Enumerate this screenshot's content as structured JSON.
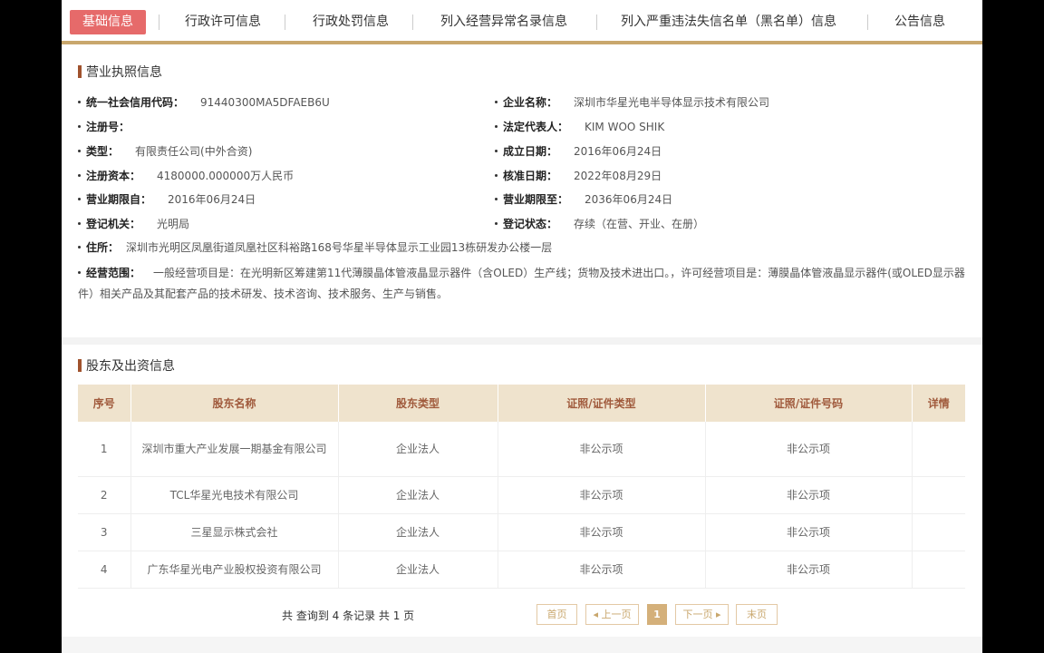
{
  "tabs": [
    {
      "label": "基础信息",
      "active": true
    },
    {
      "label": "行政许可信息"
    },
    {
      "label": "行政处罚信息"
    },
    {
      "label": "列入经营异常名录信息"
    },
    {
      "label": "列入严重违法失信名单（黑名单）信息"
    },
    {
      "label": "公告信息"
    }
  ],
  "license": {
    "title": "营业执照信息",
    "credit_code": {
      "label": "统一社会信用代码：",
      "value": "91440300MA5DFAEB6U"
    },
    "company_name": {
      "label": "企业名称：",
      "value": "深圳市华星光电半导体显示技术有限公司"
    },
    "reg_no": {
      "label": "注册号：",
      "value": ""
    },
    "legal_rep": {
      "label": "法定代表人：",
      "value": "KIM WOO SHIK"
    },
    "type": {
      "label": "类型：",
      "value": "有限责任公司(中外合资)"
    },
    "founded": {
      "label": "成立日期：",
      "value": "2016年06月24日"
    },
    "capital": {
      "label": "注册资本：",
      "value": "4180000.000000万人民币"
    },
    "approval_date": {
      "label": "核准日期：",
      "value": "2022年08月29日"
    },
    "term_from": {
      "label": "营业期限自：",
      "value": "2016年06月24日"
    },
    "term_to": {
      "label": "营业期限至：",
      "value": "2036年06月24日"
    },
    "authority": {
      "label": "登记机关：",
      "value": "光明局"
    },
    "status": {
      "label": "登记状态：",
      "value": "存续（在营、开业、在册）"
    },
    "address": {
      "label": "住所：",
      "value": "深圳市光明区凤凰街道凤凰社区科裕路168号华星半导体显示工业园13栋研发办公楼一层"
    },
    "scope": {
      "label": "经营范围：",
      "value": "一般经营项目是：在光明新区筹建第11代薄膜晶体管液晶显示器件（含OLED）生产线；货物及技术进出口。，许可经营项目是：薄膜晶体管液晶显示器件(或OLED显示器件）相关产品及其配套产品的技术研发、技术咨询、技术服务、生产与销售。"
    }
  },
  "shareholders": {
    "title": "股东及出资信息",
    "headers": [
      "序号",
      "股东名称",
      "股东类型",
      "证照/证件类型",
      "证照/证件号码",
      "详情"
    ],
    "rows": [
      [
        "1",
        "深圳市重大产业发展一期基金有限公司",
        "企业法人",
        "非公示项",
        "非公示项",
        ""
      ],
      [
        "2",
        "TCL华星光电技术有限公司",
        "企业法人",
        "非公示项",
        "非公示项",
        ""
      ],
      [
        "3",
        "三星显示株式会社",
        "企业法人",
        "非公示项",
        "非公示项",
        ""
      ],
      [
        "4",
        "广东华星光电产业股权投资有限公司",
        "企业法人",
        "非公示项",
        "非公示项",
        ""
      ]
    ]
  },
  "pager": {
    "info": "共 查询到 4 条记录 共 1 页",
    "first": "首页",
    "prev": "◂ 上一页",
    "current": "1",
    "next": "下一页 ▸",
    "last": "末页"
  },
  "colors": {
    "active_tab": "#e66a6a",
    "gold": "#c9a76d",
    "header_bg": "#efe3cd",
    "header_text": "#a05a3c"
  }
}
